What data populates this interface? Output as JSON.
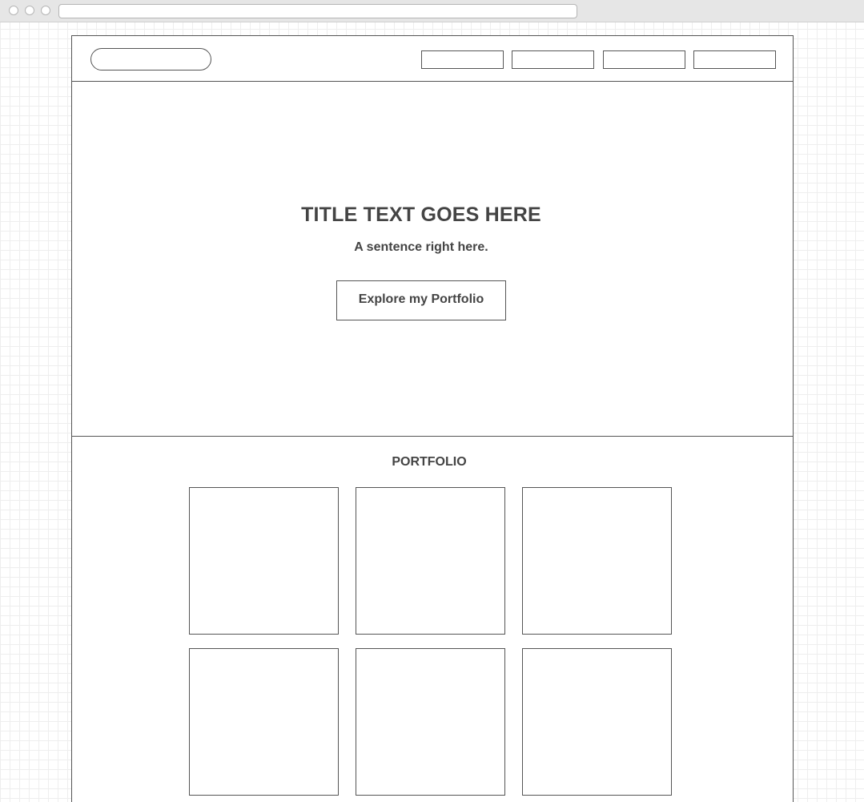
{
  "hero": {
    "title": "TITLE TEXT GOES HERE",
    "subtitle": "A sentence right here.",
    "cta_label": "Explore my Portfolio"
  },
  "portfolio": {
    "heading": "PORTFOLIO"
  }
}
